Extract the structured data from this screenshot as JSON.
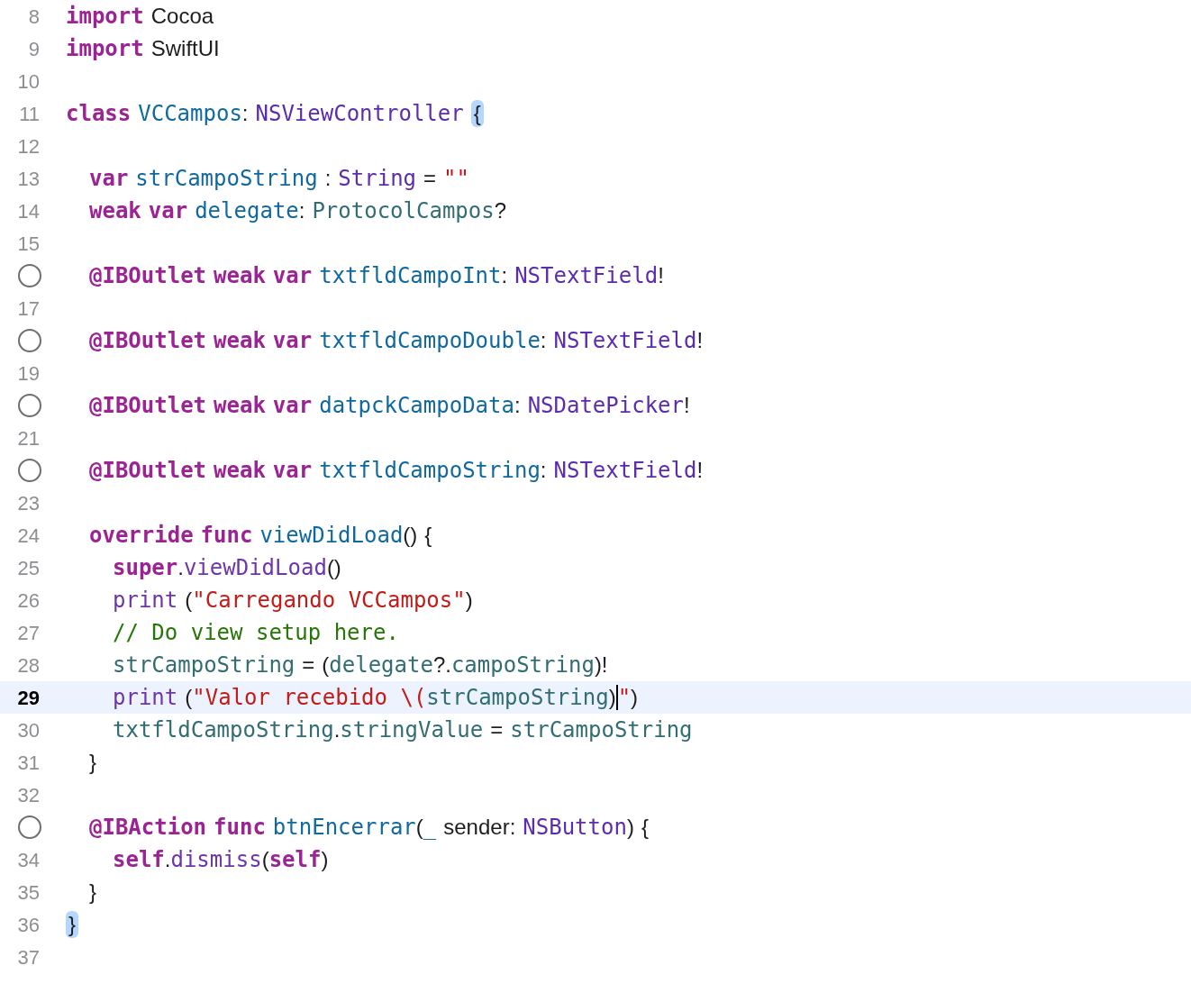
{
  "lines": [
    {
      "number": "8",
      "current": false,
      "tokens": [
        {
          "kind": "kw",
          "text": "import"
        },
        {
          "kind": "plain",
          "text": "Cocoa",
          "sp": true
        }
      ]
    },
    {
      "number": "9",
      "current": false,
      "tokens": [
        {
          "kind": "kw",
          "text": "import"
        },
        {
          "kind": "plain",
          "text": "SwiftUI",
          "sp": true
        }
      ]
    },
    {
      "number": "10",
      "current": false
    },
    {
      "number": "11",
      "current": false,
      "tokens": [
        {
          "kind": "kw",
          "text": "class"
        },
        {
          "kind": "decl",
          "text": "VCCampos",
          "sp": true
        },
        {
          "kind": "plain",
          "text": ":"
        },
        {
          "kind": "type",
          "text": "NSViewController",
          "sp": true
        },
        {
          "kind": "match",
          "text": "{",
          "sp": true
        }
      ],
      "children": [
        {
          "number": "12",
          "current": false
        },
        {
          "number": "13",
          "current": false,
          "tokens": [
            {
              "kind": "kw",
              "text": "var"
            },
            {
              "kind": "decl",
              "text": "strCampoString",
              "sp": true
            },
            {
              "kind": "plain",
              "text": ":",
              "sp": true
            },
            {
              "kind": "type",
              "text": "String",
              "sp": true
            },
            {
              "kind": "plain",
              "text": "=",
              "sp": true
            },
            {
              "kind": "str",
              "text": "\"\"",
              "sp": true
            }
          ]
        },
        {
          "number": "14",
          "current": false,
          "tokens": [
            {
              "kind": "kw",
              "text": "weak"
            },
            {
              "kind": "kw",
              "text": "var",
              "sp": true
            },
            {
              "kind": "decl",
              "text": "delegate",
              "sp": true
            },
            {
              "kind": "plain",
              "text": ":"
            },
            {
              "kind": "proj",
              "text": "ProtocolCampos",
              "sp": true
            },
            {
              "kind": "plain",
              "text": "?"
            }
          ]
        },
        {
          "number": "15",
          "current": false
        },
        {
          "outlet_marker": true,
          "current": false,
          "tokens": [
            {
              "kind": "kw",
              "text": "@IBOutlet"
            },
            {
              "kind": "kw",
              "text": "weak",
              "sp": true
            },
            {
              "kind": "kw",
              "text": "var",
              "sp": true
            },
            {
              "kind": "decl",
              "text": "txtfldCampoInt",
              "sp": true
            },
            {
              "kind": "plain",
              "text": ":"
            },
            {
              "kind": "type",
              "text": "NSTextField",
              "sp": true
            },
            {
              "kind": "plain",
              "text": "!"
            }
          ]
        },
        {
          "number": "17",
          "current": false
        },
        {
          "outlet_marker": true,
          "current": false,
          "tokens": [
            {
              "kind": "kw",
              "text": "@IBOutlet"
            },
            {
              "kind": "kw",
              "text": "weak",
              "sp": true
            },
            {
              "kind": "kw",
              "text": "var",
              "sp": true
            },
            {
              "kind": "decl",
              "text": "txtfldCampoDouble",
              "sp": true
            },
            {
              "kind": "plain",
              "text": ":"
            },
            {
              "kind": "type",
              "text": "NSTextField",
              "sp": true
            },
            {
              "kind": "plain",
              "text": "!"
            }
          ]
        },
        {
          "number": "19",
          "current": false
        },
        {
          "outlet_marker": true,
          "current": false,
          "tokens": [
            {
              "kind": "kw",
              "text": "@IBOutlet"
            },
            {
              "kind": "kw",
              "text": "weak",
              "sp": true
            },
            {
              "kind": "kw",
              "text": "var",
              "sp": true
            },
            {
              "kind": "decl",
              "text": "datpckCampoData",
              "sp": true
            },
            {
              "kind": "plain",
              "text": ":"
            },
            {
              "kind": "type",
              "text": "NSDatePicker",
              "sp": true
            },
            {
              "kind": "plain",
              "text": "!"
            }
          ]
        },
        {
          "number": "21",
          "current": false
        },
        {
          "outlet_marker": true,
          "current": false,
          "tokens": [
            {
              "kind": "kw",
              "text": "@IBOutlet"
            },
            {
              "kind": "kw",
              "text": "weak",
              "sp": true
            },
            {
              "kind": "kw",
              "text": "var",
              "sp": true
            },
            {
              "kind": "decl",
              "text": "txtfldCampoString",
              "sp": true
            },
            {
              "kind": "plain",
              "text": ":"
            },
            {
              "kind": "type",
              "text": "NSTextField",
              "sp": true
            },
            {
              "kind": "plain",
              "text": "!"
            }
          ]
        },
        {
          "number": "23",
          "current": false
        },
        {
          "number": "24",
          "current": false,
          "tokens": [
            {
              "kind": "kw",
              "text": "override"
            },
            {
              "kind": "kw",
              "text": "func",
              "sp": true
            },
            {
              "kind": "decl",
              "text": "viewDidLoad",
              "sp": true
            },
            {
              "kind": "plain",
              "text": "()"
            },
            {
              "kind": "plain",
              "text": "{",
              "sp": true
            }
          ],
          "children": [
            {
              "number": "25",
              "current": false,
              "tokens": [
                {
                  "kind": "kw",
                  "text": "super"
                },
                {
                  "kind": "plain",
                  "text": "."
                },
                {
                  "kind": "sys",
                  "text": "viewDidLoad"
                },
                {
                  "kind": "plain",
                  "text": "()"
                }
              ]
            },
            {
              "number": "26",
              "current": false,
              "tokens": [
                {
                  "kind": "sys",
                  "text": "print"
                },
                {
                  "kind": "plain",
                  "text": "(",
                  "sp": true
                },
                {
                  "kind": "str",
                  "text": "\"Carregando VCCampos\""
                },
                {
                  "kind": "plain",
                  "text": ")"
                }
              ]
            },
            {
              "number": "27",
              "current": false,
              "tokens": [
                {
                  "kind": "comment",
                  "text": "// Do view setup here."
                }
              ]
            },
            {
              "number": "28",
              "current": false,
              "tokens": [
                {
                  "kind": "proj",
                  "text": "strCampoString"
                },
                {
                  "kind": "plain",
                  "text": "=",
                  "sp": true
                },
                {
                  "kind": "plain",
                  "text": "(",
                  "sp": true
                },
                {
                  "kind": "proj",
                  "text": "delegate"
                },
                {
                  "kind": "plain",
                  "text": "?."
                },
                {
                  "kind": "proj",
                  "text": "campoString"
                },
                {
                  "kind": "plain",
                  "text": ")!"
                }
              ]
            },
            {
              "number": "29",
              "current": true,
              "tokens": [
                {
                  "kind": "sys",
                  "text": "print"
                },
                {
                  "kind": "plain",
                  "text": "(",
                  "sp": true
                },
                {
                  "kind": "str",
                  "text": "\"Valor recebido \\("
                },
                {
                  "kind": "proj",
                  "text": "strCampoString"
                },
                {
                  "kind": "plain",
                  "text": ")"
                },
                {
                  "kind": "str",
                  "text": "\"",
                  "cursor_before": true
                },
                {
                  "kind": "plain",
                  "text": ")"
                }
              ]
            },
            {
              "number": "30",
              "current": false,
              "tokens": [
                {
                  "kind": "proj",
                  "text": "txtfldCampoString"
                },
                {
                  "kind": "plain",
                  "text": "."
                },
                {
                  "kind": "proj",
                  "text": "stringValue"
                },
                {
                  "kind": "plain",
                  "text": "=",
                  "sp": true
                },
                {
                  "kind": "proj",
                  "text": "strCampoString",
                  "sp": true
                }
              ]
            }
          ]
        },
        {
          "number": "31",
          "current": false,
          "tokens": [
            {
              "kind": "plain",
              "text": "}"
            }
          ]
        },
        {
          "number": "32",
          "current": false
        },
        {
          "outlet_marker": true,
          "current": false,
          "tokens": [
            {
              "kind": "kw",
              "text": "@IBAction"
            },
            {
              "kind": "kw",
              "text": "func",
              "sp": true
            },
            {
              "kind": "decl",
              "text": "btnEncerrar",
              "sp": true
            },
            {
              "kind": "plain",
              "text": "("
            },
            {
              "kind": "decl",
              "text": "_"
            },
            {
              "kind": "plain",
              "text": "sender",
              "sp": true
            },
            {
              "kind": "plain",
              "text": ":"
            },
            {
              "kind": "type",
              "text": "NSButton",
              "sp": true
            },
            {
              "kind": "plain",
              "text": ")"
            },
            {
              "kind": "plain",
              "text": "{",
              "sp": true
            }
          ],
          "children": [
            {
              "number": "34",
              "current": false,
              "tokens": [
                {
                  "kind": "kw",
                  "text": "self"
                },
                {
                  "kind": "plain",
                  "text": "."
                },
                {
                  "kind": "sys",
                  "text": "dismiss"
                },
                {
                  "kind": "plain",
                  "text": "("
                },
                {
                  "kind": "kw",
                  "text": "self"
                },
                {
                  "kind": "plain",
                  "text": ")"
                }
              ]
            }
          ]
        },
        {
          "number": "35",
          "current": false,
          "tokens": [
            {
              "kind": "plain",
              "text": "}"
            }
          ]
        }
      ]
    },
    {
      "number": "36",
      "current": false,
      "tokens": [
        {
          "kind": "match",
          "text": "}"
        }
      ]
    },
    {
      "number": "37",
      "current": false
    }
  ]
}
